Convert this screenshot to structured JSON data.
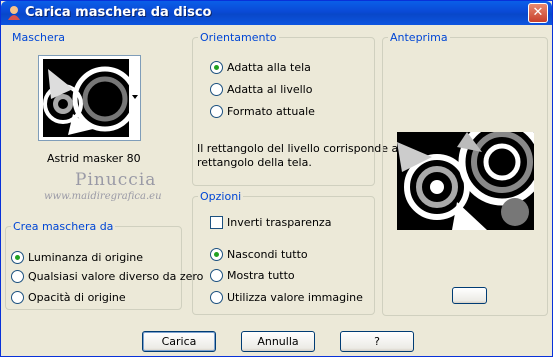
{
  "window": {
    "title": "Carica maschera da disco",
    "close_glyph": "✕"
  },
  "mask": {
    "group_label": "Maschera",
    "selected_name": "Astrid masker 80",
    "watermark_line1": "Pinuccia",
    "watermark_line2": "www.maidiregrafica.eu"
  },
  "create_from": {
    "group_label": "Crea maschera da",
    "options": [
      "Luminanza di origine",
      "Qualsiasi valore diverso da zero",
      "Opacità di origine"
    ],
    "selected": 0
  },
  "orientation": {
    "group_label": "Orientamento",
    "options": [
      "Adatta alla tela",
      "Adatta al livello",
      "Formato attuale"
    ],
    "selected": 0,
    "description_line1": "Il rettangolo del livello corrisponde al",
    "description_line2": "rettangolo della tela."
  },
  "options": {
    "group_label": "Opzioni",
    "invert_label": "Inverti trasparenza",
    "invert_checked": false,
    "options": [
      "Nascondi tutto",
      "Mostra tutto",
      "Utilizza valore immagine"
    ],
    "selected": 0
  },
  "preview": {
    "group_label": "Anteprima"
  },
  "buttons": {
    "load": "Carica",
    "cancel": "Annulla",
    "help": "?"
  },
  "colors": {
    "title_bar": "#0a4ad6",
    "group_label": "#0046d5",
    "face": "#ece9d8",
    "radio_dot": "#21a121"
  },
  "icons": [
    "app-icon",
    "close-icon",
    "dropdown-arrow-icon",
    "preview-toggle-icon"
  ]
}
